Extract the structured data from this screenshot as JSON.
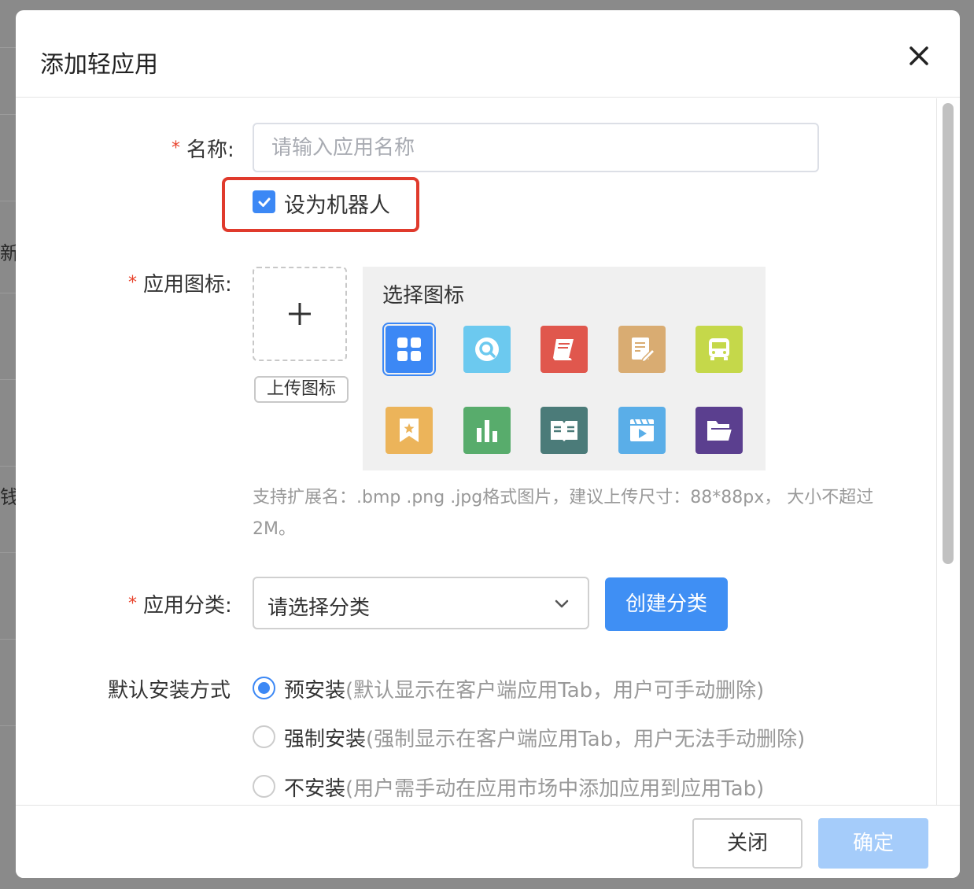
{
  "background": {
    "side_texts": [
      "新",
      "钱"
    ]
  },
  "modal": {
    "title": "添加轻应用",
    "close_icon": "close-icon",
    "name_label": "名称:",
    "name_placeholder": "请输入应用名称",
    "robot_checkbox": {
      "label": "设为机器人",
      "checked": true
    },
    "icon_label": "应用图标:",
    "upload_button": "上传图标",
    "icon_panel_title": "选择图标",
    "icons": [
      {
        "name": "grid-icon",
        "color": "#3c88f5",
        "selected": true
      },
      {
        "name": "search-icon",
        "color": "#6cc9ef",
        "selected": false
      },
      {
        "name": "book-icon",
        "color": "#e0574d",
        "selected": false
      },
      {
        "name": "edit-note-icon",
        "color": "#d9ac72",
        "selected": false
      },
      {
        "name": "bus-icon",
        "color": "#c5d84a",
        "selected": false
      },
      {
        "name": "bookmark-icon",
        "color": "#ecb45a",
        "selected": false
      },
      {
        "name": "bar-chart-icon",
        "color": "#58ac6c",
        "selected": false
      },
      {
        "name": "open-book-icon",
        "color": "#4b7b79",
        "selected": false
      },
      {
        "name": "video-icon",
        "color": "#5aaee8",
        "selected": false
      },
      {
        "name": "folder-icon",
        "color": "#5b3f8f",
        "selected": false
      }
    ],
    "hint": "支持扩展名：.bmp .png .jpg格式图片，建议上传尺寸：88*88px， 大小不超过2M。",
    "category_label": "应用分类:",
    "category_placeholder": "请选择分类",
    "create_category_button": "创建分类",
    "install_label": "默认安装方式",
    "install_options": [
      {
        "label": "预安装",
        "desc": "(默认显示在客户端应用Tab，用户可手动删除)",
        "checked": true
      },
      {
        "label": "强制安装",
        "desc": "(强制显示在客户端应用Tab，用户无法手动删除)",
        "checked": false
      },
      {
        "label": "不安装",
        "desc": "(用户需手动在应用市场中添加应用到应用Tab)",
        "checked": false
      }
    ],
    "footer": {
      "close_button": "关闭",
      "ok_button": "确定"
    },
    "accent_color": "#3c88f5",
    "required_color": "#e8432c"
  }
}
